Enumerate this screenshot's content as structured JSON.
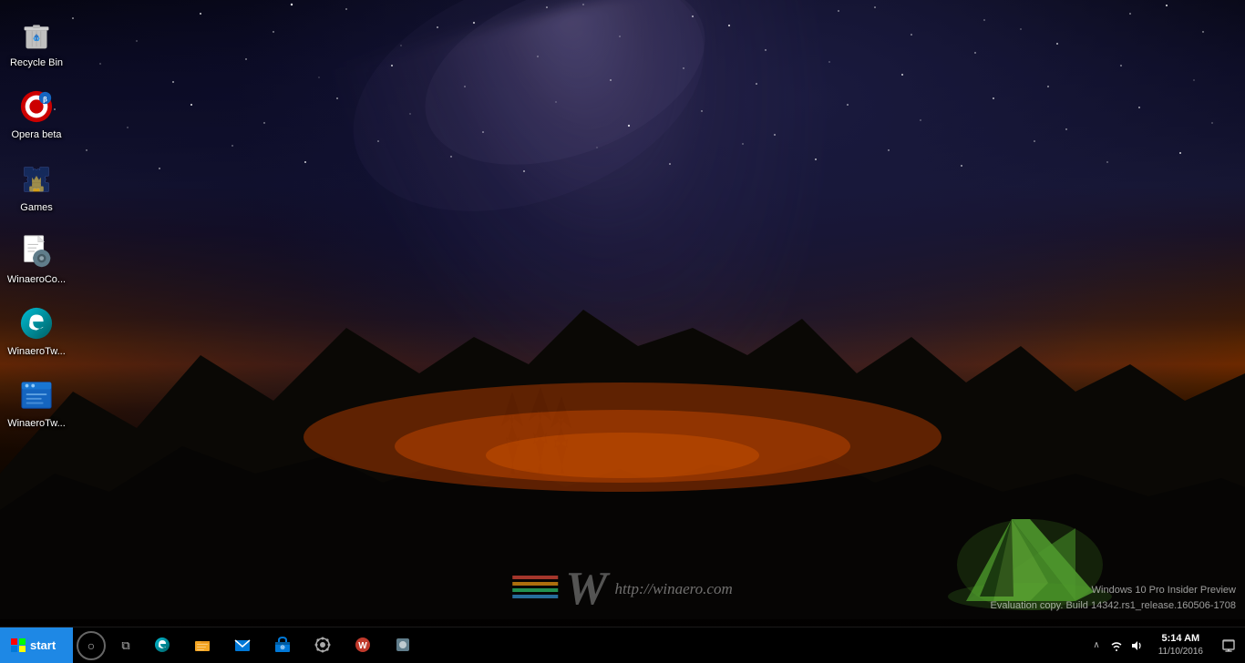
{
  "desktop": {
    "icons": [
      {
        "id": "recycle-bin",
        "label": "Recycle Bin",
        "type": "recycle-bin"
      },
      {
        "id": "opera-beta",
        "label": "Opera beta",
        "type": "opera"
      },
      {
        "id": "games",
        "label": "Games",
        "type": "games"
      },
      {
        "id": "winaero-config",
        "label": "WinaeroCo...",
        "type": "config"
      },
      {
        "id": "winaero-tweaker-1",
        "label": "WinaeroTw...",
        "type": "tweaker"
      },
      {
        "id": "winaero-tweaker-2",
        "label": "WinaeroTw...",
        "type": "tweaker2"
      }
    ]
  },
  "watermark": {
    "url": "http://winaero.com"
  },
  "buildinfo": {
    "line1": "Windows 10 Pro Insider Preview",
    "line2": "Evaluation copy. Build 14342.rs1_release.160506-1708"
  },
  "taskbar": {
    "start_label": "start",
    "clock": {
      "time": "5:14 AM",
      "date": "▼"
    },
    "apps": [
      {
        "id": "edge",
        "color": "#0078d7"
      },
      {
        "id": "file-explorer",
        "color": "#f5a623"
      },
      {
        "id": "mail",
        "color": "#0078d7"
      },
      {
        "id": "store",
        "color": "#0078d7"
      },
      {
        "id": "settings",
        "color": "#aaa"
      },
      {
        "id": "app6",
        "color": "#c0392b"
      },
      {
        "id": "app7",
        "color": "#888"
      }
    ]
  }
}
